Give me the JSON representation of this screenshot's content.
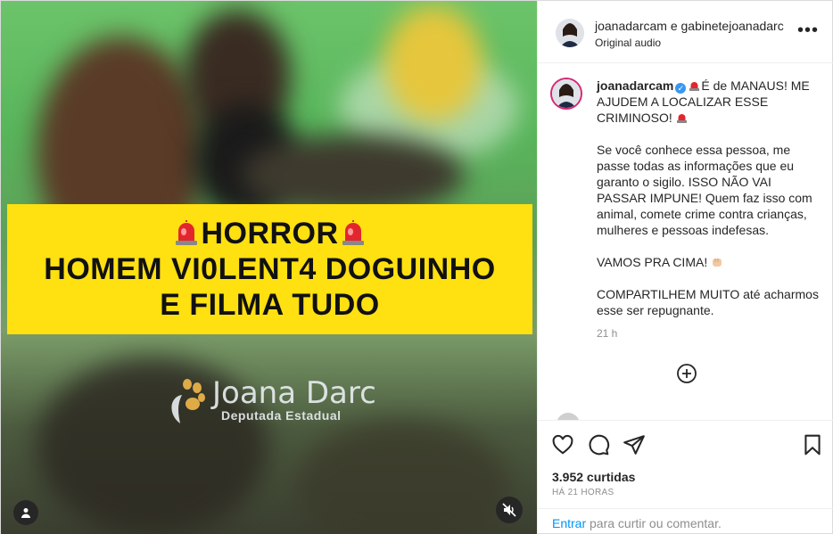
{
  "media": {
    "banner_line1": "HORROR",
    "banner_line2": "HOMEM VI0LENT4 DOGUINHO",
    "banner_line3": "E FILMA TUDO",
    "watermark_name": "Joana Darc",
    "watermark_subtitle": "Deputada Estadual",
    "icons": [
      "police-siren-icon",
      "user-tag-icon",
      "audio-muted-icon"
    ]
  },
  "header": {
    "names": "joanadarcam e gabinetejoanadarc",
    "audio": "Original audio",
    "more_icon": "more-options-icon"
  },
  "caption": {
    "username": "joanadarcam",
    "line1": "É de MANAUS! ME AJUDEM A LOCALIZAR ESSE CRIMINOSO!",
    "paragraph2": "Se você conhece essa pessoa, me passe todas as informações que eu garanto o sigilo. ISSO NÃO VAI PASSAR IMPUNE! Quem faz isso com animal, comete crime contra crianças, mulheres e pessoas indefesas.",
    "paragraph3": "VAMOS PRA CIMA!",
    "paragraph4": "COMPARTILHEM MUITO até acharmos esse ser repugnante.",
    "time": "21 h"
  },
  "actions": {
    "likes": "3.952 curtidas",
    "posted_ago": "HÁ 21 HORAS",
    "add_comment_link": "Entrar",
    "add_comment_text": "para curtir ou comentar."
  },
  "colors": {
    "banner": "#ffe011",
    "link": "#0095f6",
    "story_ring": "#d62976",
    "verified": "#3897f0"
  }
}
